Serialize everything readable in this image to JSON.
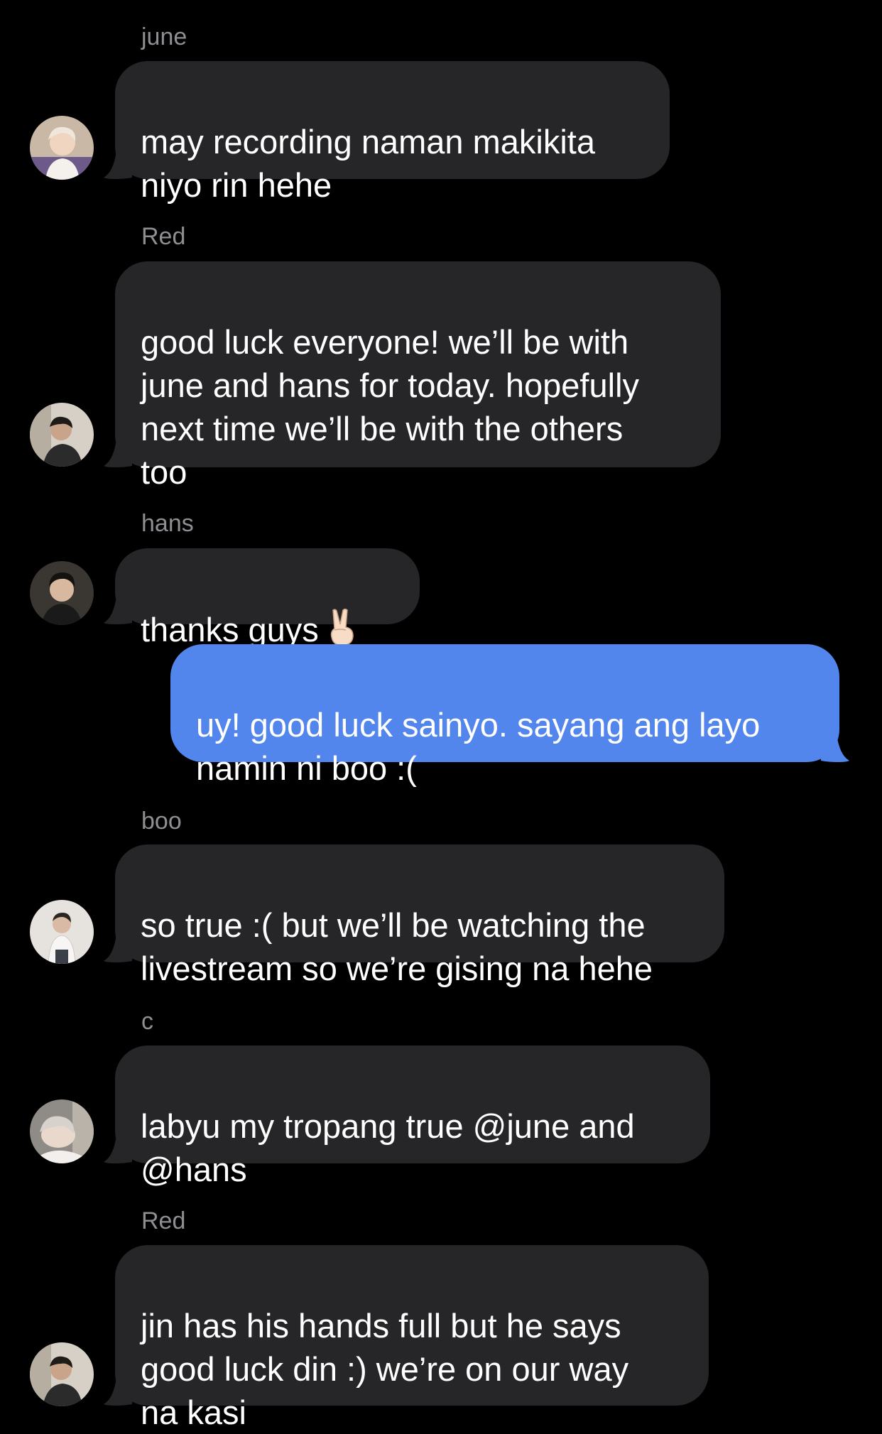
{
  "conversation": {
    "messages": [
      {
        "sender": "june",
        "text": "may recording naman makikita\nniyo rin hehe"
      },
      {
        "sender": "Red",
        "text": "good luck everyone! we’ll be with\njune and hans for today. hopefully\nnext time we’ll be with the others\ntoo"
      },
      {
        "sender": "hans",
        "text": "thanks guys",
        "emoji": "victory-hand"
      },
      {
        "sender": "",
        "text": "uy! good luck sainyo. sayang ang layo\nnamin ni boo :("
      },
      {
        "sender": "boo",
        "text": "so true :( but we’ll be watching the\nlivestream so we’re gising na hehe"
      },
      {
        "sender": "c",
        "text": "labyu my tropang true @june and\n@hans"
      },
      {
        "sender": "Red",
        "text": "jin has his hands full but he says\ngood luck din :) we’re on our way\nna kasi"
      }
    ]
  },
  "colors": {
    "background": "#000000",
    "incoming_bubble": "#262628",
    "outgoing_bubble": "#5386ed",
    "sender_name": "#8e8e93",
    "text": "#ffffff"
  },
  "icons": {
    "avatars": [
      "june-avatar",
      "red-avatar",
      "hans-avatar",
      "boo-avatar",
      "c-avatar",
      "red-avatar"
    ],
    "emoji": "victory-hand-emoji"
  }
}
